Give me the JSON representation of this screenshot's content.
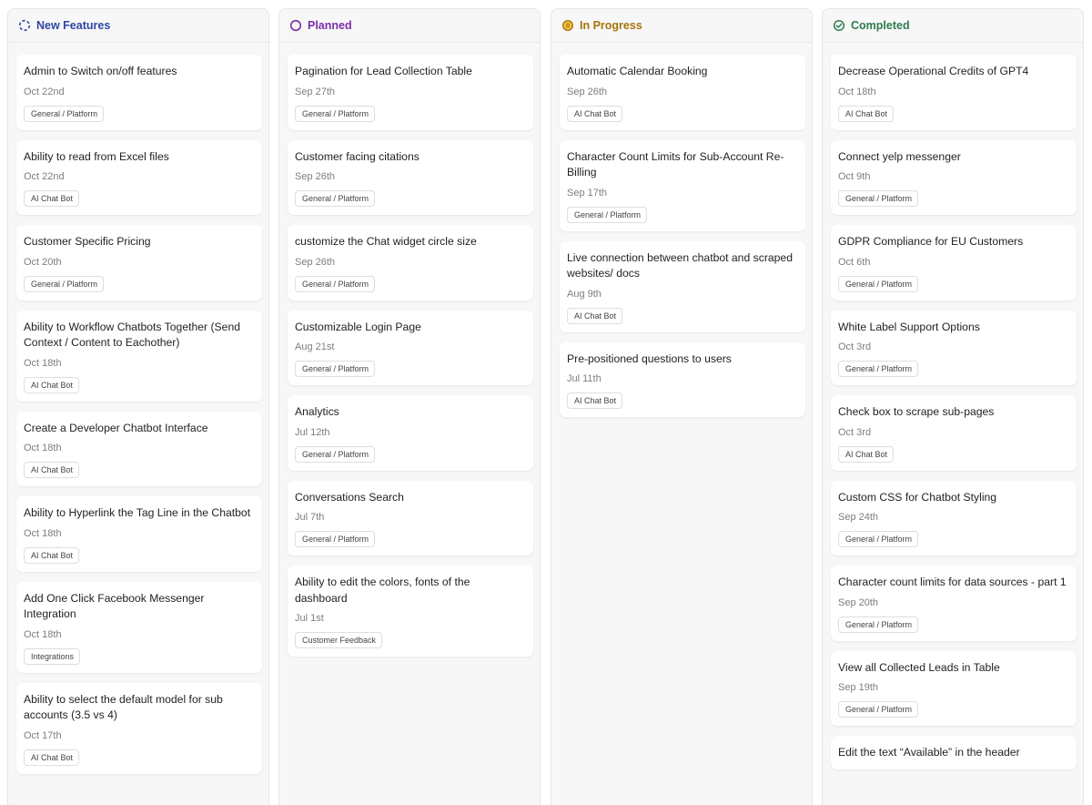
{
  "columns": [
    {
      "title": "New Features",
      "icon": "loading-circle-icon",
      "color": "#2f47a3",
      "cards": [
        {
          "title": "Admin to Switch on/off features",
          "date": "Oct 22nd",
          "tag": "General / Platform"
        },
        {
          "title": "Ability to read from Excel files",
          "date": "Oct 22nd",
          "tag": "AI Chat Bot"
        },
        {
          "title": "Customer Specific Pricing",
          "date": "Oct 20th",
          "tag": "General / Platform"
        },
        {
          "title": "Ability to Workflow Chatbots Together (Send Context / Content to Eachother)",
          "date": "Oct 18th",
          "tag": "AI Chat Bot"
        },
        {
          "title": "Create a Developer Chatbot Interface",
          "date": "Oct 18th",
          "tag": "AI Chat Bot"
        },
        {
          "title": "Ability to Hyperlink the Tag Line in the Chatbot",
          "date": "Oct 18th",
          "tag": "AI Chat Bot"
        },
        {
          "title": "Add One Click Facebook Messenger Integration",
          "date": "Oct 18th",
          "tag": "Integrations"
        },
        {
          "title": "Ability to select the default model for sub accounts (3.5 vs 4)",
          "date": "Oct 17th",
          "tag": "AI Chat Bot"
        }
      ]
    },
    {
      "title": "Planned",
      "icon": "circle-outline-icon",
      "color": "#7b2fa8",
      "cards": [
        {
          "title": "Pagination for Lead Collection Table",
          "date": "Sep 27th",
          "tag": "General / Platform"
        },
        {
          "title": "Customer facing citations",
          "date": "Sep 26th",
          "tag": "General / Platform"
        },
        {
          "title": "customize the Chat widget circle size",
          "date": "Sep 26th",
          "tag": "General / Platform"
        },
        {
          "title": "Customizable Login Page",
          "date": "Aug 21st",
          "tag": "General / Platform"
        },
        {
          "title": "Analytics",
          "date": "Jul 12th",
          "tag": "General / Platform"
        },
        {
          "title": "Conversations Search",
          "date": "Jul 7th",
          "tag": "General / Platform"
        },
        {
          "title": "Ability to edit the colors, fonts of the dashboard",
          "date": "Jul 1st",
          "tag": "Customer Feedback"
        }
      ]
    },
    {
      "title": "In Progress",
      "icon": "pause-circle-icon",
      "color": "#a8730d",
      "cards": [
        {
          "title": "Automatic Calendar Booking",
          "date": "Sep 26th",
          "tag": "AI Chat Bot"
        },
        {
          "title": "Character Count Limits for Sub-Account Re-Billing",
          "date": "Sep 17th",
          "tag": "General / Platform"
        },
        {
          "title": "Live connection between chatbot and scraped websites/ docs",
          "date": "Aug 9th",
          "tag": "AI Chat Bot"
        },
        {
          "title": "Pre-positioned questions to users",
          "date": "Jul 11th",
          "tag": "AI Chat Bot"
        }
      ]
    },
    {
      "title": "Completed",
      "icon": "check-circle-icon",
      "color": "#2e7d4f",
      "cards": [
        {
          "title": "Decrease Operational Credits of GPT4",
          "date": "Oct 18th",
          "tag": "AI Chat Bot"
        },
        {
          "title": "Connect yelp messenger",
          "date": "Oct 9th",
          "tag": "General / Platform"
        },
        {
          "title": "GDPR Compliance for EU Customers",
          "date": "Oct 6th",
          "tag": "General / Platform"
        },
        {
          "title": "White Label Support Options",
          "date": "Oct 3rd",
          "tag": "General / Platform"
        },
        {
          "title": "Check box to scrape sub-pages",
          "date": "Oct 3rd",
          "tag": "AI Chat Bot"
        },
        {
          "title": "Custom CSS for Chatbot Styling",
          "date": "Sep 24th",
          "tag": "General / Platform"
        },
        {
          "title": "Character count limits for data sources - part 1",
          "date": "Sep 20th",
          "tag": "General / Platform"
        },
        {
          "title": "View all Collected Leads in Table",
          "date": "Sep 19th",
          "tag": "General / Platform"
        },
        {
          "title": "Edit the text “Available” in the header",
          "date": "",
          "tag": ""
        }
      ]
    }
  ]
}
